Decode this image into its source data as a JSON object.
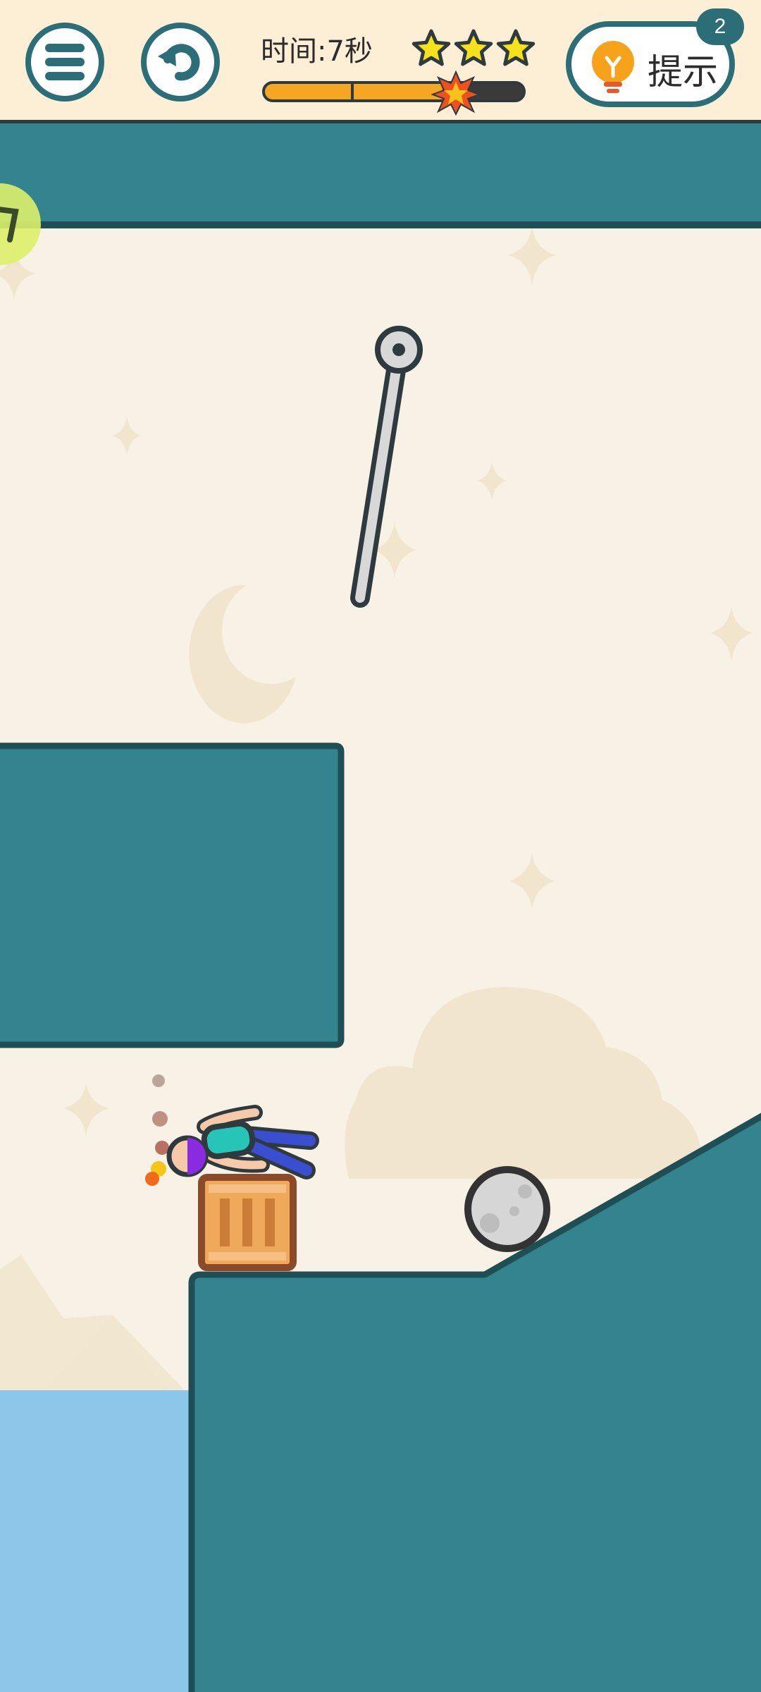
{
  "hud": {
    "timer_text": "时间:7秒",
    "stars": {
      "earned": 3,
      "total": 3
    },
    "progress": 0.7,
    "hint_label": "提示",
    "hint_count": "2"
  },
  "icons": {
    "menu": "menu-icon",
    "restart": "restart-icon",
    "hint": "lightbulb-icon",
    "star": "star-icon"
  },
  "colors": {
    "teal": "#34848f",
    "teal_dark": "#1f4e55",
    "star": "#f7e11b",
    "progress": "#f5a623",
    "water": "#8cc7ea",
    "sky": "#f8f2e6"
  }
}
